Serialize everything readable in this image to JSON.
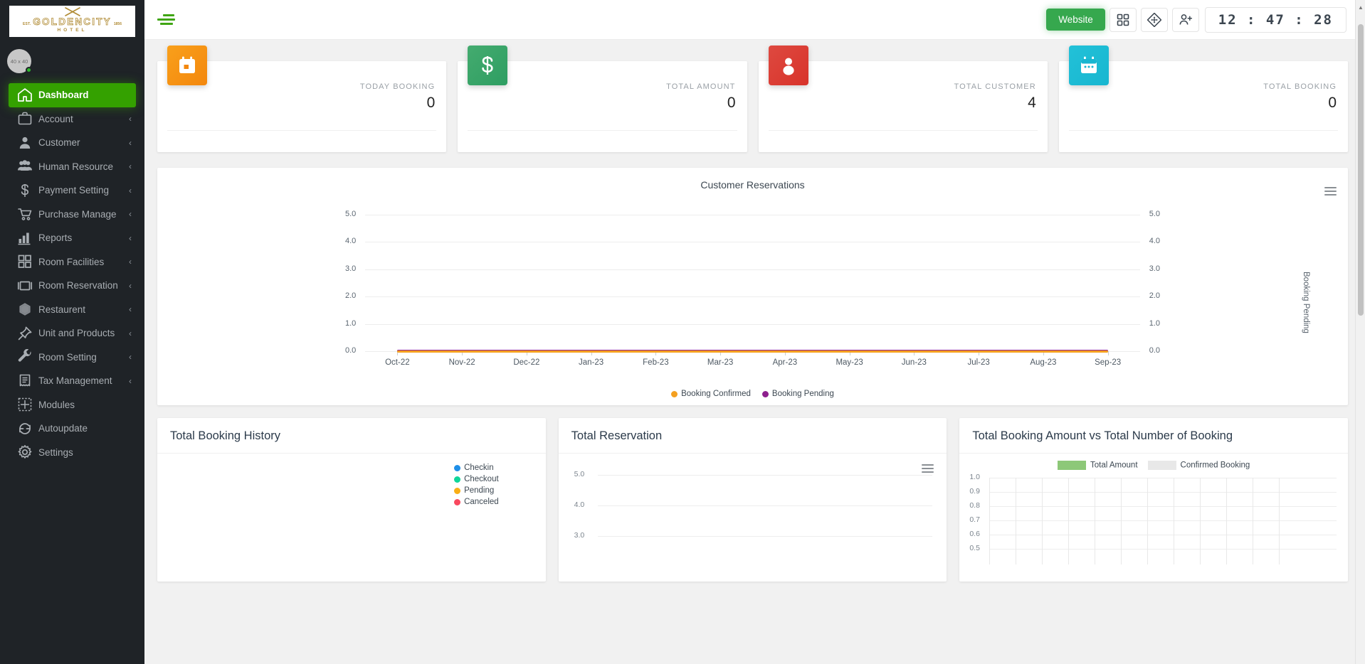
{
  "brand": {
    "est": "EST.",
    "name": "GOLDENCITY",
    "year": "1856",
    "sub": "HOTEL"
  },
  "avatar": {
    "placeholder_text": "40 x 40"
  },
  "sidebar": {
    "items": [
      {
        "label": "Dashboard",
        "icon": "home-icon",
        "active": true,
        "caret": false
      },
      {
        "label": "Account",
        "icon": "briefcase-icon",
        "active": false,
        "caret": true
      },
      {
        "label": "Customer",
        "icon": "user-icon",
        "active": false,
        "caret": true
      },
      {
        "label": "Human Resource",
        "icon": "users-icon",
        "active": false,
        "caret": true
      },
      {
        "label": "Payment Setting",
        "icon": "dollar-icon",
        "active": false,
        "caret": true
      },
      {
        "label": "Purchase Manage",
        "icon": "cart-icon",
        "active": false,
        "caret": true
      },
      {
        "label": "Reports",
        "icon": "bar-chart-icon",
        "active": false,
        "caret": true
      },
      {
        "label": "Room Facilities",
        "icon": "grid-icon",
        "active": false,
        "caret": true
      },
      {
        "label": "Room Reservation",
        "icon": "bed-icon",
        "active": false,
        "caret": true
      },
      {
        "label": "Restaurent",
        "icon": "hexagon-icon",
        "active": false,
        "caret": true
      },
      {
        "label": "Unit and Products",
        "icon": "pin-icon",
        "active": false,
        "caret": true
      },
      {
        "label": "Room Setting",
        "icon": "wrench-icon",
        "active": false,
        "caret": true
      },
      {
        "label": "Tax Management",
        "icon": "receipt-icon",
        "active": false,
        "caret": true
      },
      {
        "label": "Modules",
        "icon": "modules-icon",
        "active": false,
        "caret": false
      },
      {
        "label": "Autoupdate",
        "icon": "refresh-icon",
        "active": false,
        "caret": false
      },
      {
        "label": "Settings",
        "icon": "gear-icon",
        "active": false,
        "caret": false
      }
    ]
  },
  "topbar": {
    "menu_toggle": "hamburger-icon",
    "website_button": "Website",
    "icons": [
      {
        "name": "apps-grid-icon"
      },
      {
        "name": "move-diamond-icon"
      },
      {
        "name": "add-user-icon"
      }
    ],
    "clock": "12 : 47 : 28"
  },
  "stat_cards": [
    {
      "label": "TODAY BOOKING",
      "value": "0",
      "icon": "calendar-icon",
      "color": "#f3870d",
      "color2": "#f9a01b"
    },
    {
      "label": "TOTAL AMOUNT",
      "value": "0",
      "icon": "dollar-icon",
      "color": "#2e9e62",
      "color2": "#44ab6f"
    },
    {
      "label": "TOTAL CUSTOMER",
      "value": "4",
      "icon": "user-circle-icon",
      "color": "#d8332a",
      "color2": "#de4940"
    },
    {
      "label": "TOTAL BOOKING",
      "value": "0",
      "icon": "calendar-days-icon",
      "color": "#18b6d0",
      "color2": "#22c1d8"
    }
  ],
  "chart_data": [
    {
      "id": "customer-reservations",
      "type": "line",
      "title": "Customer Reservations",
      "categories": [
        "Oct-22",
        "Nov-22",
        "Dec-22",
        "Jan-23",
        "Feb-23",
        "Mar-23",
        "Apr-23",
        "May-23",
        "Jun-23",
        "Jul-23",
        "Aug-23",
        "Sep-23"
      ],
      "ylabel": "Booking Confirmed",
      "y2label": "Booking Pending",
      "ylim": [
        0,
        5
      ],
      "y2lim": [
        0,
        5
      ],
      "yticks": [
        "0.0",
        "1.0",
        "2.0",
        "3.0",
        "4.0",
        "5.0"
      ],
      "y2ticks": [
        "0.0",
        "1.0",
        "2.0",
        "3.0",
        "4.0",
        "5.0"
      ],
      "grid": true,
      "legend_position": "bottom",
      "series": [
        {
          "name": "Booking Confirmed",
          "color": "#f4a020",
          "values": [
            0,
            0,
            0,
            0,
            0,
            0,
            0,
            0,
            0,
            0,
            0,
            0
          ]
        },
        {
          "name": "Booking Pending",
          "color": "#8e1f8e",
          "values": [
            0,
            0,
            0,
            0,
            0,
            0,
            0,
            0,
            0,
            0,
            0,
            0
          ]
        }
      ]
    },
    {
      "id": "total-booking-history",
      "type": "pie",
      "title": "Total Booking History",
      "legend_position": "right",
      "slices": [
        {
          "name": "Checkin",
          "value": 0,
          "color": "#1e8fe8"
        },
        {
          "name": "Checkout",
          "value": 0,
          "color": "#0fd69a"
        },
        {
          "name": "Pending",
          "value": 0,
          "color": "#f9ae15"
        },
        {
          "name": "Canceled",
          "value": 0,
          "color": "#f9485e"
        }
      ]
    },
    {
      "id": "total-reservation",
      "type": "line",
      "title": "Total Reservation",
      "ylim": [
        0,
        5
      ],
      "yticks": [
        "3.0",
        "4.0",
        "5.0"
      ],
      "grid": true,
      "series": [
        {
          "name": "Total Reservation",
          "color": "#1e8fe8",
          "values": []
        }
      ]
    },
    {
      "id": "total-booking-amount-vs-number",
      "type": "bar",
      "title": "Total Booking Amount vs Total Number of Booking",
      "ylim": [
        0,
        1
      ],
      "yticks": [
        "0.5",
        "0.6",
        "0.7",
        "0.8",
        "0.9",
        "1.0"
      ],
      "grid": true,
      "legend_position": "top",
      "series": [
        {
          "name": "Total Amount",
          "color": "#8dc878",
          "values": []
        },
        {
          "name": "Confirmed Booking",
          "color": "#e8e8e8",
          "values": []
        }
      ]
    }
  ],
  "colors": {
    "accent_green": "#34a100",
    "website_green": "#36a84e",
    "sidebar_bg": "#1f2327",
    "page_bg": "#f1f1f1"
  }
}
